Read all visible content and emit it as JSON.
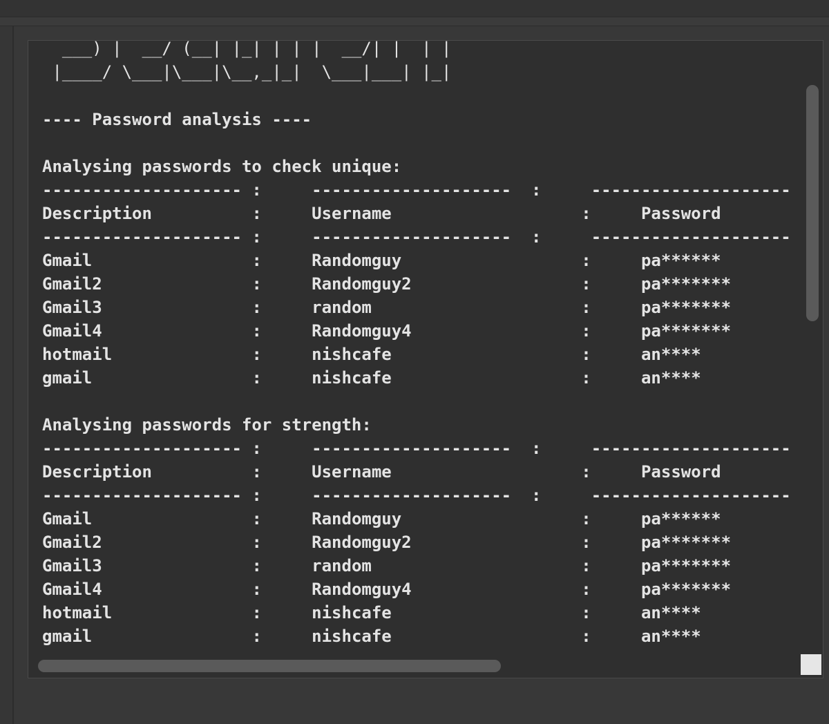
{
  "ascii_art": {
    "line1": "  ___) |  __/ (__| |_| | | |  __/| |  | |",
    "line2": " |____/ \\___|\\___|\\__,_|_|  \\___|___| |_|"
  },
  "heading": "---- Password analysis ----",
  "unique_section": {
    "title": "Analysing passwords to check unique:",
    "columns": [
      "Description",
      "Username",
      "Password"
    ],
    "rows": [
      [
        "Gmail",
        "Randomguy",
        "pa******"
      ],
      [
        "Gmail2",
        "Randomguy2",
        "pa*******"
      ],
      [
        "Gmail3",
        "random",
        "pa*******"
      ],
      [
        "Gmail4",
        "Randomguy4",
        "pa*******"
      ],
      [
        "hotmail",
        "nishcafe",
        "an****"
      ],
      [
        "gmail",
        "nishcafe",
        "an****"
      ]
    ]
  },
  "strength_section": {
    "title": "Analysing passwords for strength:",
    "columns": [
      "Description",
      "Username",
      "Password"
    ],
    "rows": [
      [
        "Gmail",
        "Randomguy",
        "pa******"
      ],
      [
        "Gmail2",
        "Randomguy2",
        "pa*******"
      ],
      [
        "Gmail3",
        "random",
        "pa*******"
      ],
      [
        "Gmail4",
        "Randomguy4",
        "pa*******"
      ],
      [
        "hotmail",
        "nishcafe",
        "an****"
      ],
      [
        "gmail",
        "nishcafe",
        "an****"
      ]
    ]
  },
  "scroll": {
    "vertical_thumb_fraction": 0.37,
    "horizontal_thumb_fraction": 0.59
  }
}
